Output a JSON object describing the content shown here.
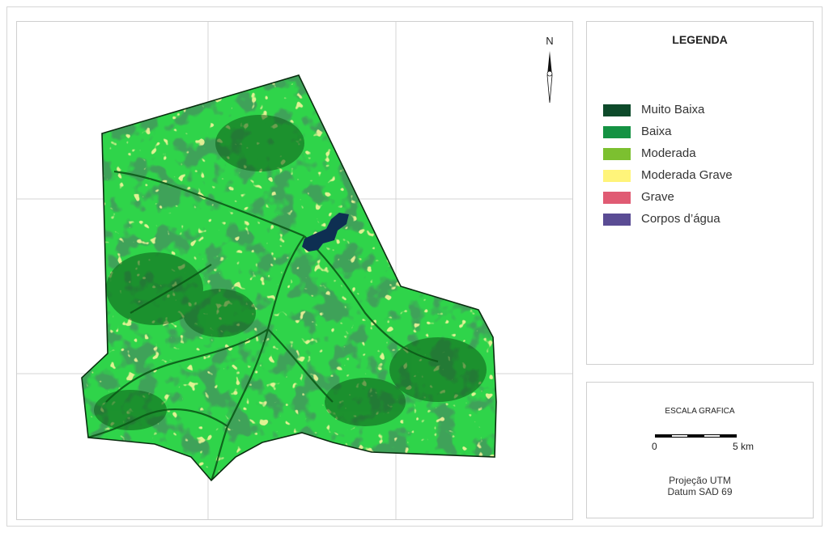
{
  "legend": {
    "title": "LEGENDA",
    "items": [
      {
        "label": "Muito Baixa",
        "color": "#0d4a2a"
      },
      {
        "label": "Baixa",
        "color": "#159243"
      },
      {
        "label": "Moderada",
        "color": "#7cc030"
      },
      {
        "label": "Moderada Grave",
        "color": "#fff47a"
      },
      {
        "label": "Grave",
        "color": "#e05b73"
      },
      {
        "label": "Corpos d’água",
        "color": "#5a4c94"
      }
    ]
  },
  "north": {
    "label": "N"
  },
  "scale": {
    "title": "ESCALA GRAFICA",
    "min_label": "0",
    "max_label": "5 km"
  },
  "projection": {
    "line1": "Projeção UTM",
    "line2": "Datum SAD 69"
  },
  "map": {
    "base_color": "#2fd44a",
    "dark_color": "#0c5a18",
    "outline_color": "#0a2e10",
    "water_color": "#0e2f52",
    "grid_color": "#d4d4d4"
  }
}
